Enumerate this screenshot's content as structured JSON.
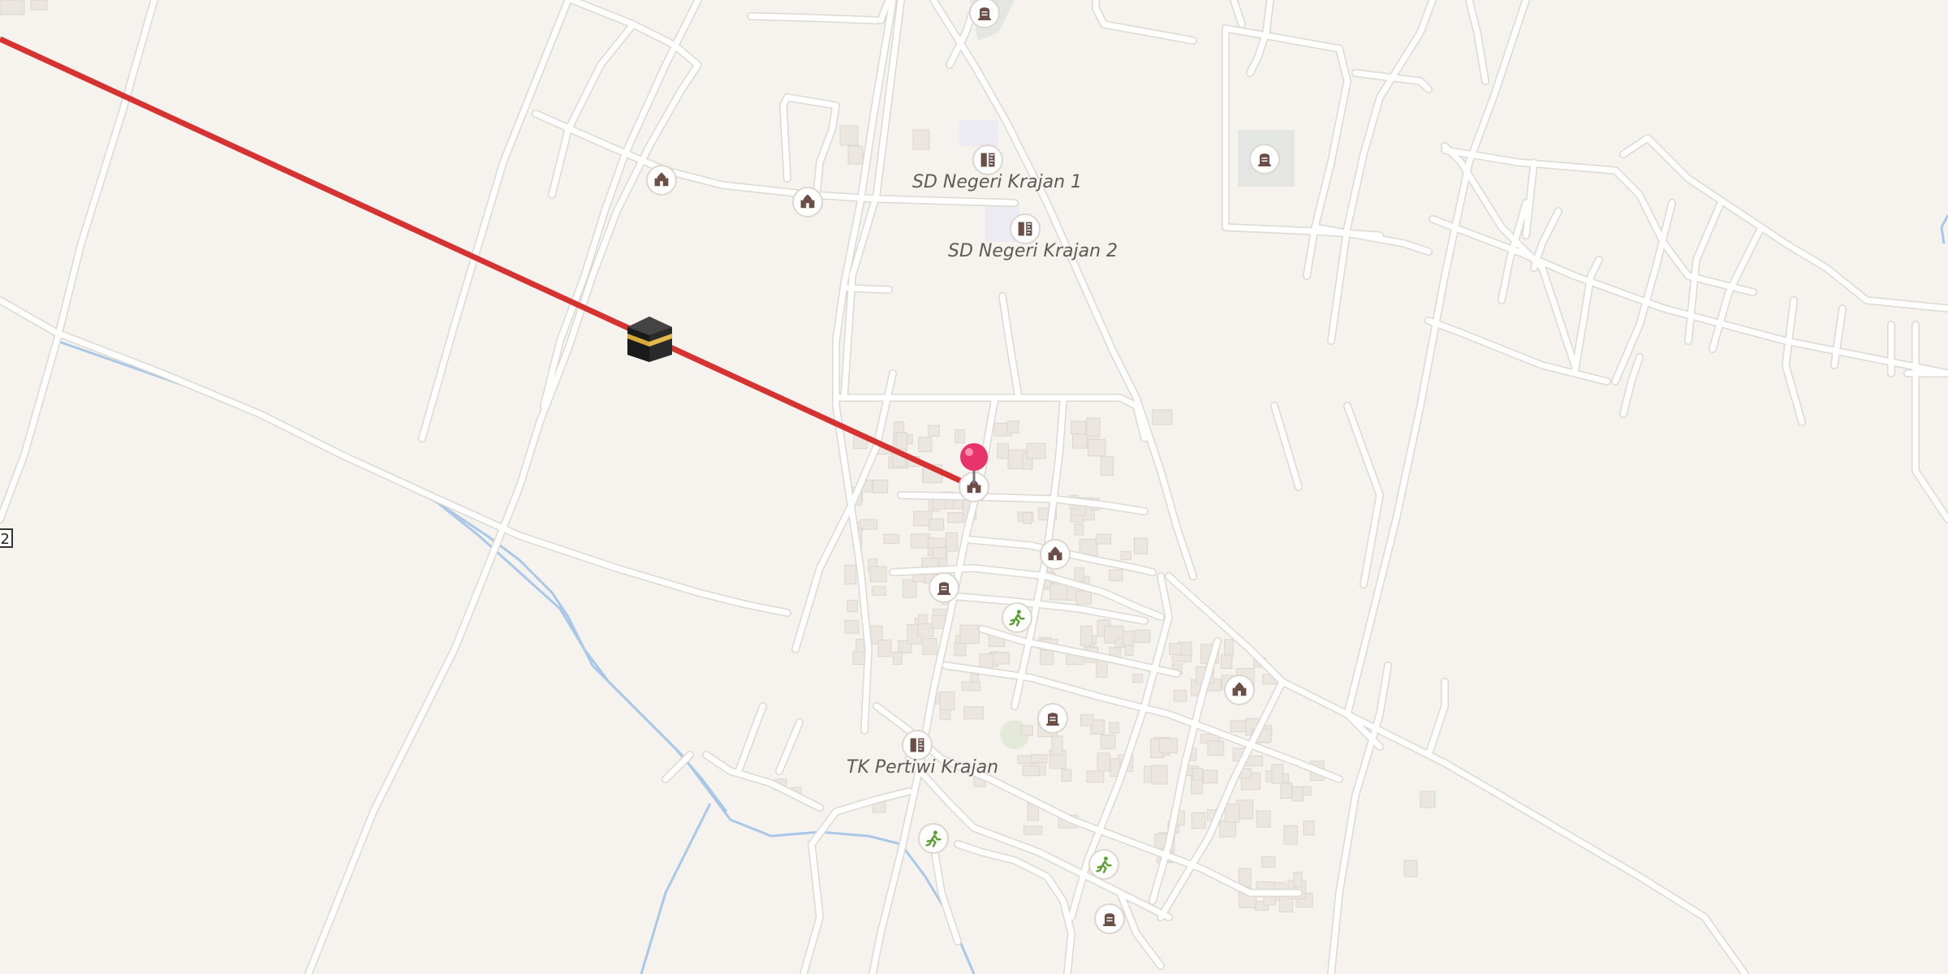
{
  "map": {
    "labels": {
      "sd1": "SD Negeri Krajan 1",
      "sd2": "SD Negeri Krajan 2",
      "tk": "TK Pertiwi Krajan"
    },
    "road_ref": "2",
    "qibla_line_color": "#d63232",
    "location_pin_color": "#e8336d",
    "poi_icons": {
      "mosque": "mosque-icon",
      "school": "school-icon",
      "cemetery": "cemetery-icon",
      "sports": "sports-centre-icon",
      "kaaba": "kaaba-icon",
      "pin": "location-pin-icon"
    }
  }
}
